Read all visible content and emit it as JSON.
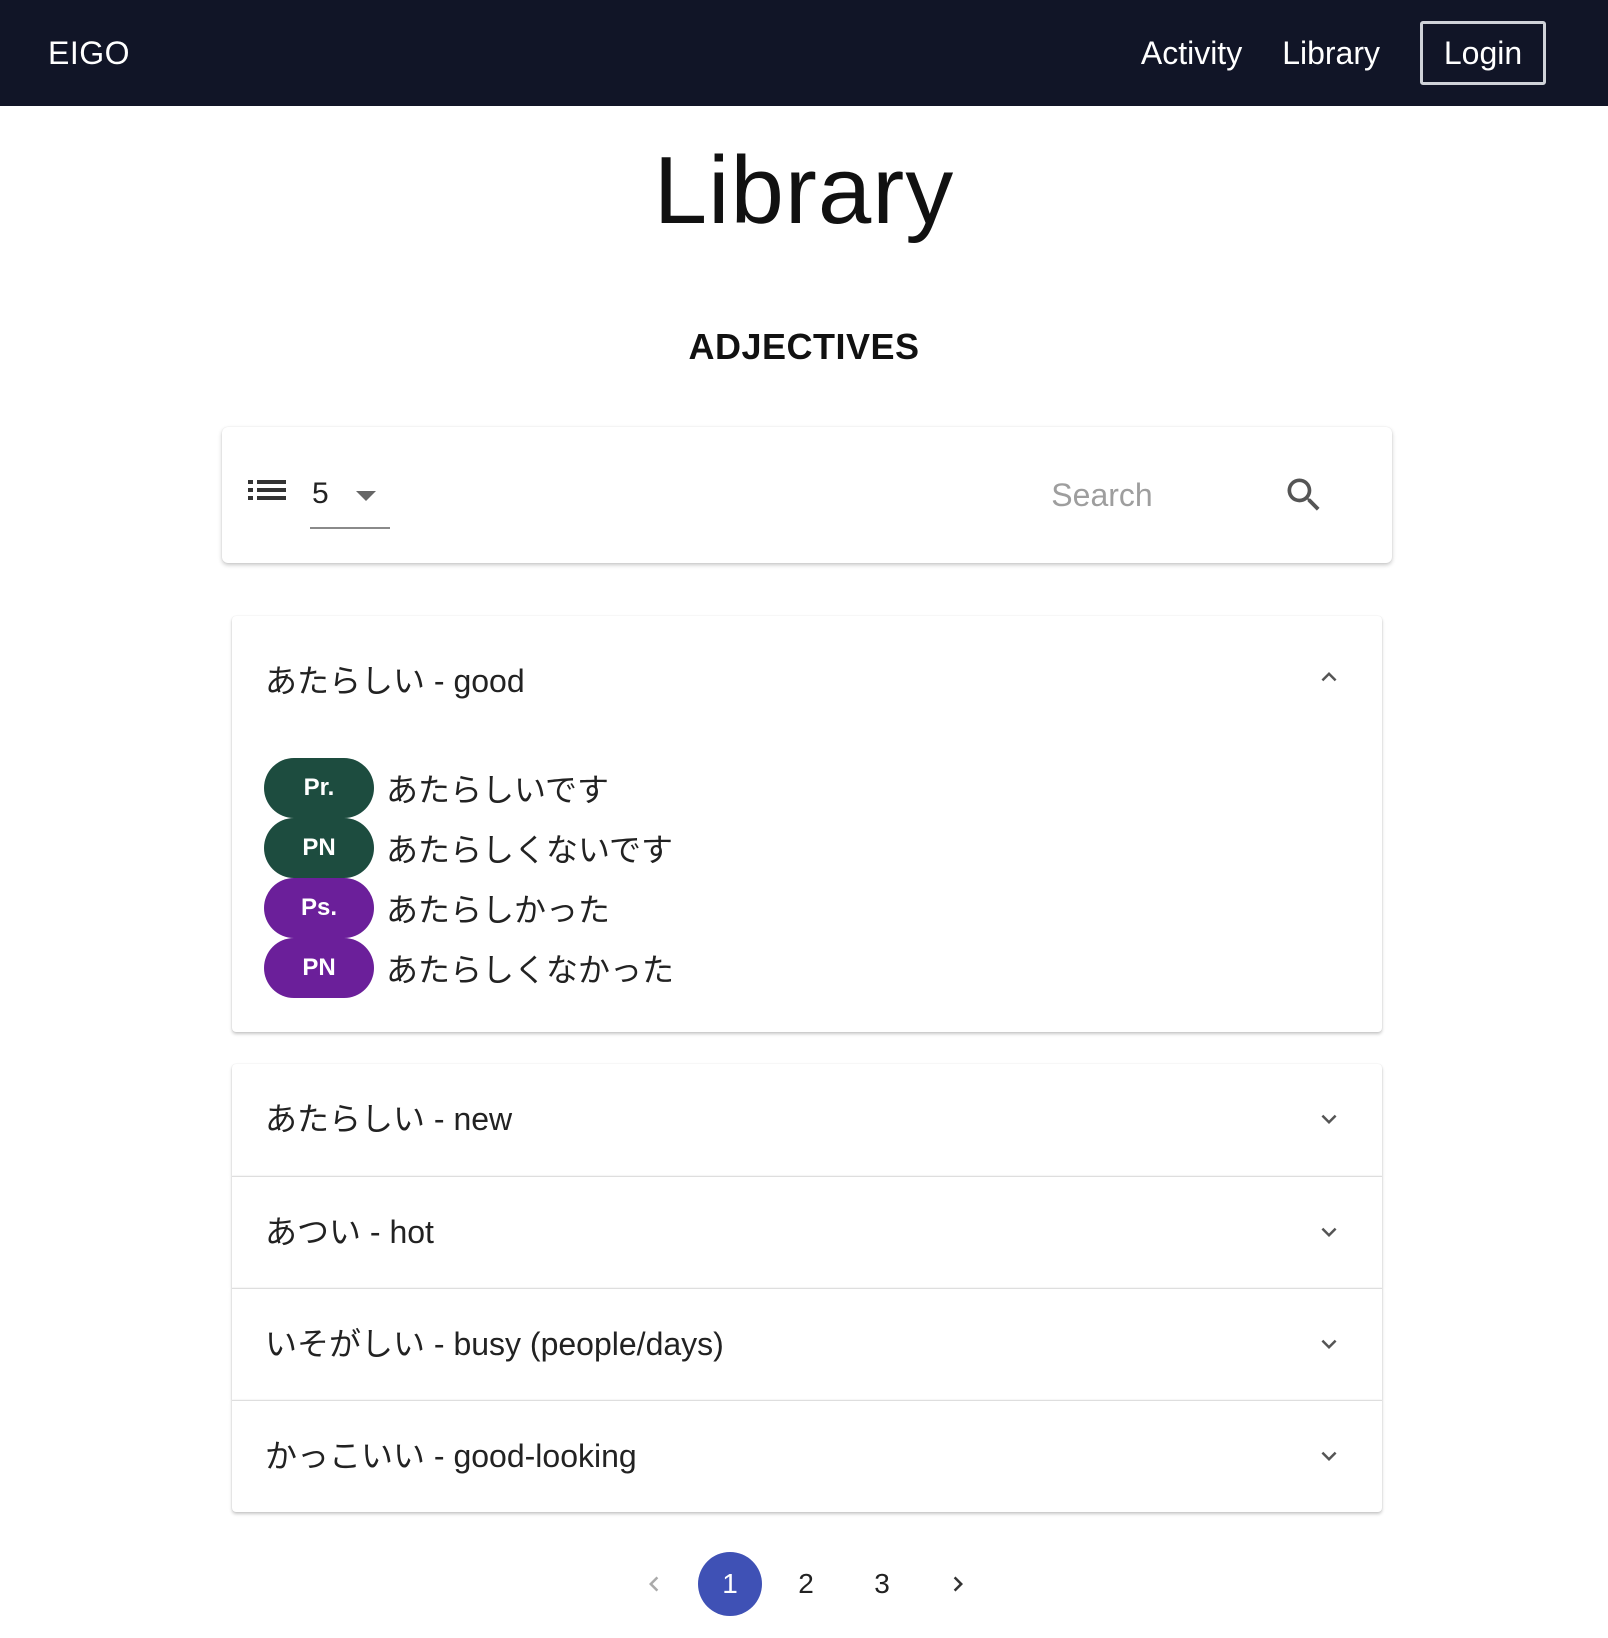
{
  "nav": {
    "brand": "EIGO",
    "links": [
      "Activity",
      "Library"
    ],
    "login": "Login"
  },
  "page": {
    "title": "Library",
    "section": "ADJECTIVES"
  },
  "toolbar": {
    "per_page": "5",
    "search_placeholder": "Search"
  },
  "entries": [
    {
      "title": "あたらしい - good",
      "expanded": true,
      "forms": [
        {
          "tag": "Pr.",
          "text": "あたらしいです",
          "color": "#1d4c3f"
        },
        {
          "tag": "PN",
          "text": "あたらしくないです",
          "color": "#1d4c3f"
        },
        {
          "tag": "Ps.",
          "text": "あたらしかった",
          "color": "#6b1f9a"
        },
        {
          "tag": "PN",
          "text": "あたらしくなかった",
          "color": "#6b1f9a"
        }
      ]
    },
    {
      "title": "あたらしい - new",
      "expanded": false
    },
    {
      "title": "あつい - hot",
      "expanded": false
    },
    {
      "title": "いそがしい - busy (people/days)",
      "expanded": false
    },
    {
      "title": "かっこいい - good-looking",
      "expanded": false
    }
  ],
  "pagination": {
    "pages": [
      "1",
      "2",
      "3"
    ],
    "current": "1"
  },
  "colors": {
    "navbar": "#111527",
    "present": "#1d4c3f",
    "past": "#6b1f9a",
    "accent": "#3f51b5"
  }
}
